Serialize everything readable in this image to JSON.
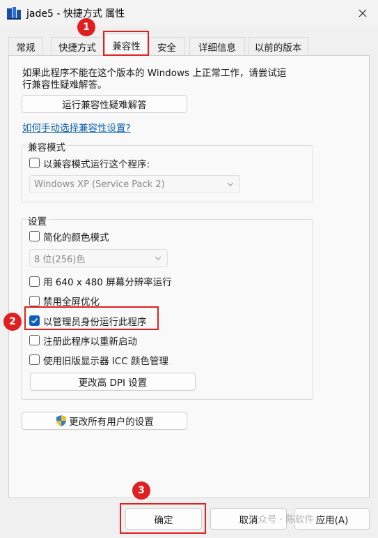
{
  "window": {
    "title": "jade5 - 快捷方式 属性"
  },
  "tabs": [
    {
      "label": "常规"
    },
    {
      "label": "快捷方式"
    },
    {
      "label": "兼容性",
      "active": true
    },
    {
      "label": "安全"
    },
    {
      "label": "详细信息"
    },
    {
      "label": "以前的版本"
    }
  ],
  "intro": {
    "line1": "如果此程序不能在这个版本的 Windows 上正常工作，请尝试运",
    "line2": "行兼容性疑难解答。"
  },
  "buttons": {
    "troubleshoot": "运行兼容性疑难解答",
    "change_dpi": "更改高 DPI 设置",
    "change_all_users": "更改所有用户的设置",
    "ok": "确定",
    "cancel": "取消",
    "apply": "应用(A)"
  },
  "manual_link": "如何手动选择兼容性设置?",
  "compat_mode": {
    "group_label": "兼容模式",
    "checkbox_label": "以兼容模式运行这个程序:",
    "checked": false,
    "os_select": "Windows XP (Service Pack 2)"
  },
  "settings": {
    "group_label": "设置",
    "reduced_color": {
      "label": "简化的颜色模式",
      "checked": false
    },
    "color_select": "8 位(256)色",
    "res_640": {
      "label": "用 640 x 480 屏幕分辨率运行",
      "checked": false
    },
    "disable_fullscreen": {
      "label": "禁用全屏优化",
      "checked": false
    },
    "run_as_admin": {
      "label": "以管理员身份运行此程序",
      "checked": true
    },
    "register_restart": {
      "label": "注册此程序以重新启动",
      "checked": false
    },
    "legacy_icc": {
      "label": "使用旧版显示器 ICC 颜色管理",
      "checked": false
    }
  },
  "annotations": {
    "badge1": "1",
    "badge2": "2",
    "badge3": "3",
    "accent": "#e02020"
  },
  "watermark": "公众号 · 陈软件"
}
